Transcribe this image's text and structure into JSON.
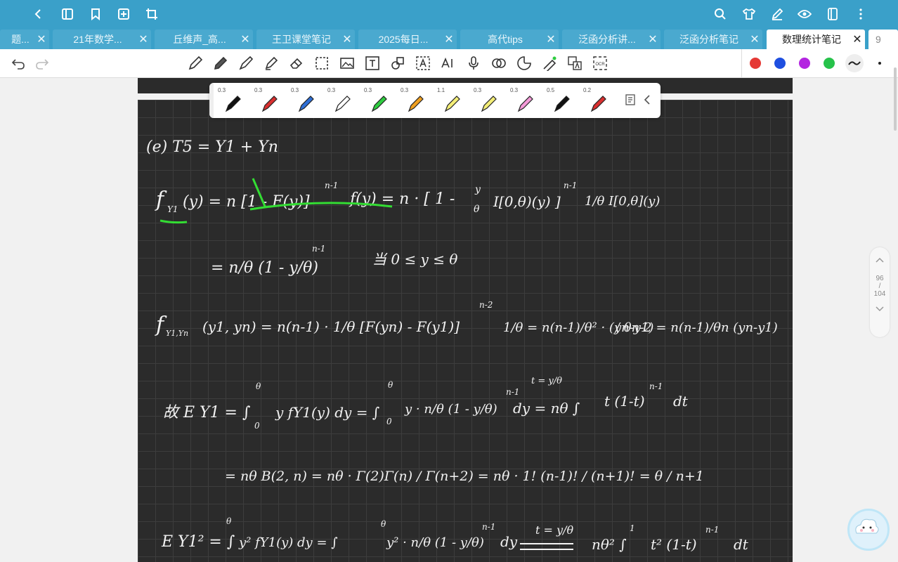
{
  "tabs": [
    {
      "label": "题..."
    },
    {
      "label": "21年数学..."
    },
    {
      "label": "丘维声_高..."
    },
    {
      "label": "王卫课堂笔记"
    },
    {
      "label": "2025每日..."
    },
    {
      "label": "高代tips"
    },
    {
      "label": "泛函分析讲..."
    },
    {
      "label": "泛函分析笔记"
    },
    {
      "label": "数理统计笔记"
    },
    {
      "label": "9"
    }
  ],
  "pens": [
    {
      "size": "0.3",
      "color": "#111111"
    },
    {
      "size": "0.3",
      "color": "#d93030"
    },
    {
      "size": "0.3",
      "color": "#2f6fd6"
    },
    {
      "size": "0.3",
      "color": "#ffffff"
    },
    {
      "size": "0.3",
      "color": "#2ecc40"
    },
    {
      "size": "0.3",
      "color": "#f0a020"
    },
    {
      "size": "1.1",
      "color": "#f4ee77"
    },
    {
      "size": "0.3",
      "color": "#f4ee77"
    },
    {
      "size": "0.3",
      "color": "#f49ad8"
    },
    {
      "size": "0.5",
      "color": "#111111"
    },
    {
      "size": "0.2",
      "color": "#d93030"
    }
  ],
  "color_palette": [
    "#e53935",
    "#1e4fe0",
    "#b325e0",
    "#26c24a"
  ],
  "pager": {
    "current": "96",
    "separator": "/",
    "total": "104"
  },
  "note": {
    "line1": "(e)   T5 = Y1 + Yn",
    "line2a": "f",
    "line2b": "(y) =  n [1 - F(y)]",
    "line2c": "n-1",
    "line2d": "f(y) = n · [ 1 -",
    "line2e": "I[0,θ)(y) ]",
    "line2f": "1/θ I[0,θ](y)",
    "line3": "= n/θ (1 - y/θ)",
    "line3sup": "n-1",
    "line3cond": "当  0 ≤ y ≤ θ",
    "line4": "f",
    "line4b": "(y1, yn) =  n(n-1) · 1/θ [F(yn) - F(y1)]",
    "line4c": "n-2",
    "line4d": "1/θ  =  n(n-1)/θ² · (yn-y1)",
    "line4e": "/ θn-2  =  n(n-1)/θn  (yn-y1)",
    "line5": "故 E Y1 = ∫",
    "line5b": "y fY1(y) dy = ∫",
    "line5c": "y · n/θ (1 - y/θ)",
    "line5d": "dy  =  nθ ∫",
    "line5e": "t (1-t)",
    "line5f": "dt",
    "line5sub": "t = y/θ",
    "line6": "=  nθ  B(2, n)  =  nθ · Γ(2)Γ(n) / Γ(n+2)  =  nθ · 1! (n-1)! / (n+1)!  =  θ / n+1",
    "line7": "E Y1² = ∫",
    "line7b": "y² fY1(y) dy = ∫",
    "line7c": "y² · n/θ (1 - y/θ)",
    "line7d": "dy",
    "line7e": "nθ² ∫",
    "line7f": "t² (1-t)",
    "line7g": "dt",
    "sup_n1": "n-1",
    "lim_theta": "θ",
    "lim_zero": "0",
    "lim_one": "1",
    "sub_y1": "Y1",
    "sub_y1yn": "Y1,Yn",
    "frac_y": "y",
    "frac_theta": "θ"
  }
}
